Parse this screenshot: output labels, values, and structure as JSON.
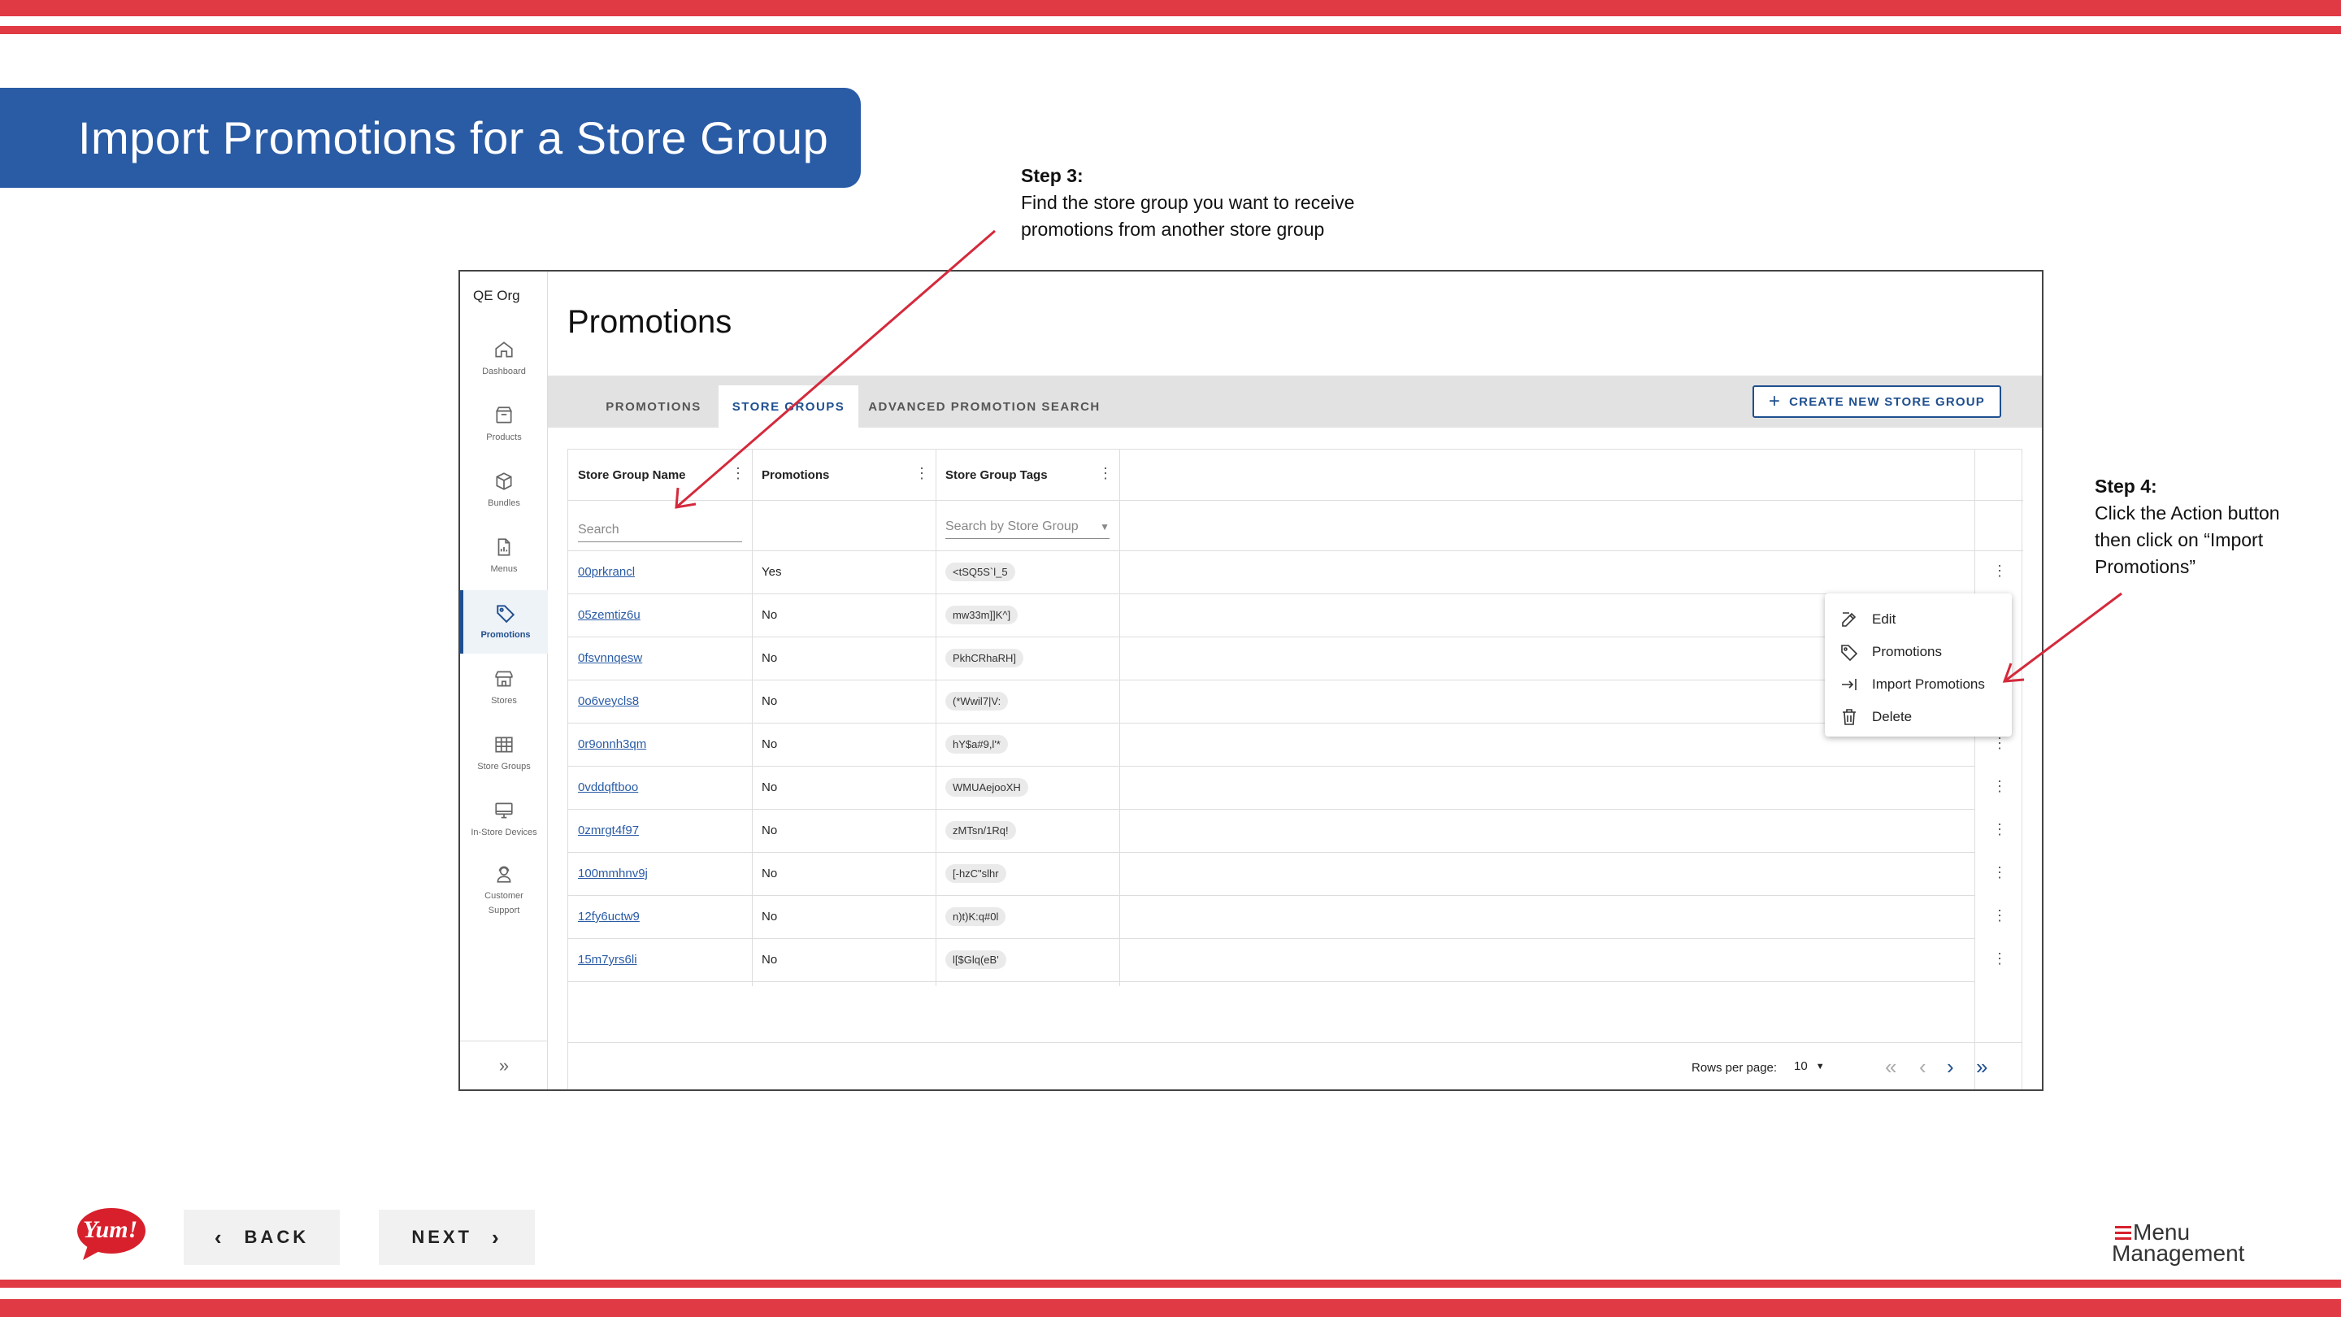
{
  "slide": {
    "title": "Import Promotions for a Store Group",
    "step3": {
      "label": "Step 3:",
      "line1": "Find the store group you want to receive",
      "line2": "promotions from another store group"
    },
    "step4": {
      "label": "Step 4:",
      "line1": "Click the Action button",
      "line2": "then click on “Import",
      "line3": "Promotions”"
    },
    "back_label": "BACK",
    "next_label": "NEXT",
    "logo_text": "Yum!",
    "brand_line1": "Menu",
    "brand_line2": "Management"
  },
  "colors": {
    "stripe": "#e03a45",
    "banner": "#2a5ba5",
    "accent": "#1f4f8f",
    "arrow": "#d42a3c"
  },
  "sidebar": {
    "org": "QE Org",
    "items": [
      {
        "label": "Dashboard",
        "icon": "home-icon"
      },
      {
        "label": "Products",
        "icon": "box-icon"
      },
      {
        "label": "Bundles",
        "icon": "cube-icon"
      },
      {
        "label": "Menus",
        "icon": "document-icon"
      },
      {
        "label": "Promotions",
        "icon": "tag-icon",
        "active": true
      },
      {
        "label": "Stores",
        "icon": "store-icon"
      },
      {
        "label": "Store Groups",
        "icon": "grid-icon"
      },
      {
        "label": "In-Store Devices",
        "icon": "monitor-icon"
      },
      {
        "label": "Customer Support",
        "icon": "support-icon"
      }
    ],
    "collapse_glyph": "»"
  },
  "main": {
    "title": "Promotions",
    "tabs": [
      "PROMOTIONS",
      "STORE GROUPS",
      "ADVANCED PROMOTION SEARCH"
    ],
    "active_tab": "STORE GROUPS",
    "create_button": "CREATE NEW STORE GROUP",
    "columns": [
      "Store Group Name",
      "Promotions",
      "Store Group Tags"
    ],
    "search_placeholder": "Search",
    "tag_search_placeholder": "Search by Store Group",
    "rows": [
      {
        "name": "00prkrancl",
        "promotions": "Yes",
        "tag": "<tSQ5S`l_5"
      },
      {
        "name": "05zemtiz6u",
        "promotions": "No",
        "tag": "mw33m]]K^]"
      },
      {
        "name": "0fsvnnqesw",
        "promotions": "No",
        "tag": "PkhCRhaRH]"
      },
      {
        "name": "0o6veycls8",
        "promotions": "No",
        "tag": "(*Wwil7|V:"
      },
      {
        "name": "0r9onnh3qm",
        "promotions": "No",
        "tag": "hY$a#9,l'*"
      },
      {
        "name": "0vddqftboo",
        "promotions": "No",
        "tag": "WMUAejooXH"
      },
      {
        "name": "0zmrgt4f97",
        "promotions": "No",
        "tag": "zMTsn/1Rq!"
      },
      {
        "name": "100mmhnv9j",
        "promotions": "No",
        "tag": "[-hzC\"slhr"
      },
      {
        "name": "12fy6uctw9",
        "promotions": "No",
        "tag": "n)t)K:q#0l"
      },
      {
        "name": "15m7yrs6li",
        "promotions": "No",
        "tag": "l[$Glq(eB'"
      }
    ],
    "action_menu": [
      "Edit",
      "Promotions",
      "Import Promotions",
      "Delete"
    ],
    "rows_per_page_label": "Rows per page:",
    "rows_per_page_value": "10"
  }
}
